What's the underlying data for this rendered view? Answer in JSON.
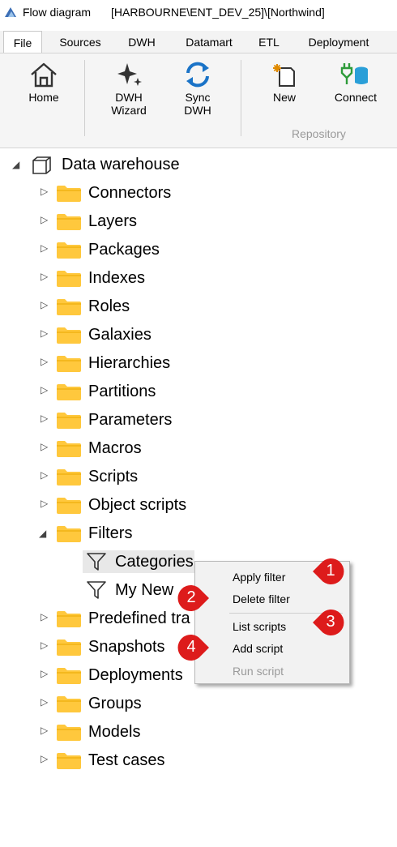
{
  "title_bar": {
    "app_name": "Flow diagram",
    "path": "[HARBOURNE\\ENT_DEV_25]\\[Northwind]"
  },
  "tabs": [
    {
      "label": "File",
      "active": true
    },
    {
      "label": "Sources"
    },
    {
      "label": "DWH"
    },
    {
      "label": "Datamart"
    },
    {
      "label": "ETL"
    },
    {
      "label": "Deployment"
    }
  ],
  "ribbon": {
    "home_label": "Home",
    "dwh_wizard_line1": "DWH",
    "dwh_wizard_line2": "Wizard",
    "sync_line1": "Sync",
    "sync_line2": "DWH",
    "new_label": "New",
    "connect_label": "Connect",
    "group_repository": "Repository"
  },
  "tree": {
    "root_label": "Data warehouse",
    "folders": [
      "Connectors",
      "Layers",
      "Packages",
      "Indexes",
      "Roles",
      "Galaxies",
      "Hierarchies",
      "Partitions",
      "Parameters",
      "Macros",
      "Scripts",
      "Object scripts",
      "Filters"
    ],
    "filter_children": [
      "Categories",
      "My New"
    ],
    "after_folders": [
      "Predefined tra",
      "Snapshots",
      "Deployments",
      "Groups",
      "Models",
      "Test cases"
    ]
  },
  "context_menu": {
    "apply_filter": "Apply filter",
    "delete_filter": "Delete filter",
    "list_scripts": "List scripts",
    "add_script": "Add script",
    "run_script": "Run script"
  },
  "badges": {
    "b1": "1",
    "b2": "2",
    "b3": "3",
    "b4": "4"
  },
  "colors": {
    "folder": "#ffc83d",
    "badge": "#dd1b1b",
    "selection": "#e8e8e8"
  }
}
